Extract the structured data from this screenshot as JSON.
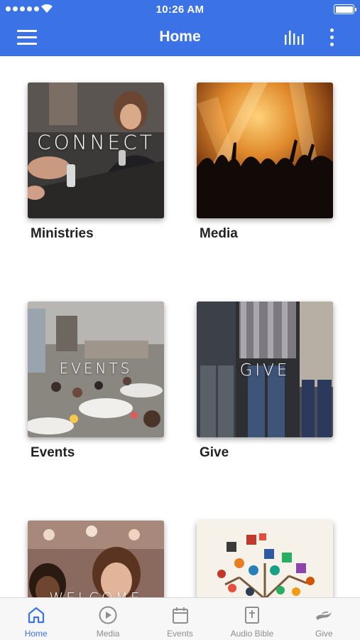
{
  "status_bar": {
    "time": "10:26 AM"
  },
  "header": {
    "title": "Home"
  },
  "tiles": [
    {
      "label": "Ministries",
      "overlay": "CONNECT"
    },
    {
      "label": "Media",
      "overlay": ""
    },
    {
      "label": "Events",
      "overlay": "EVENTS"
    },
    {
      "label": "Give",
      "overlay": "GIVE"
    },
    {
      "label": "",
      "overlay": "WELCOME"
    },
    {
      "label": "",
      "overlay": ""
    }
  ],
  "tabbar": {
    "active": "Home",
    "items": [
      {
        "label": "Home",
        "icon": "home-icon"
      },
      {
        "label": "Media",
        "icon": "play-icon"
      },
      {
        "label": "Events",
        "icon": "calendar-icon"
      },
      {
        "label": "Audio Bible",
        "icon": "bible-icon"
      },
      {
        "label": "Give",
        "icon": "giving-hand-icon"
      }
    ]
  },
  "colors": {
    "accent": "#3b73e6",
    "tab_inactive": "#8e8e8e"
  }
}
